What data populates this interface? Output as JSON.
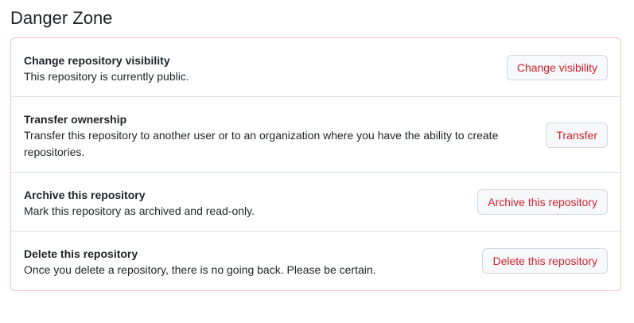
{
  "section": {
    "title": "Danger Zone"
  },
  "rows": [
    {
      "title": "Change repository visibility",
      "description": "This repository is currently public.",
      "button": "Change visibility"
    },
    {
      "title": "Transfer ownership",
      "description": "Transfer this repository to another user or to an organization where you have the ability to create repositories.",
      "button": "Transfer"
    },
    {
      "title": "Archive this repository",
      "description": "Mark this repository as archived and read-only.",
      "button": "Archive this repository"
    },
    {
      "title": "Delete this repository",
      "description": "Once you delete a repository, there is no going back. Please be certain.",
      "button": "Delete this repository"
    }
  ],
  "colors": {
    "danger_text": "#cf222e",
    "danger_border": "#ffc1c7",
    "row_divider": "#d8dee4",
    "button_bg": "#f6f8fa"
  }
}
